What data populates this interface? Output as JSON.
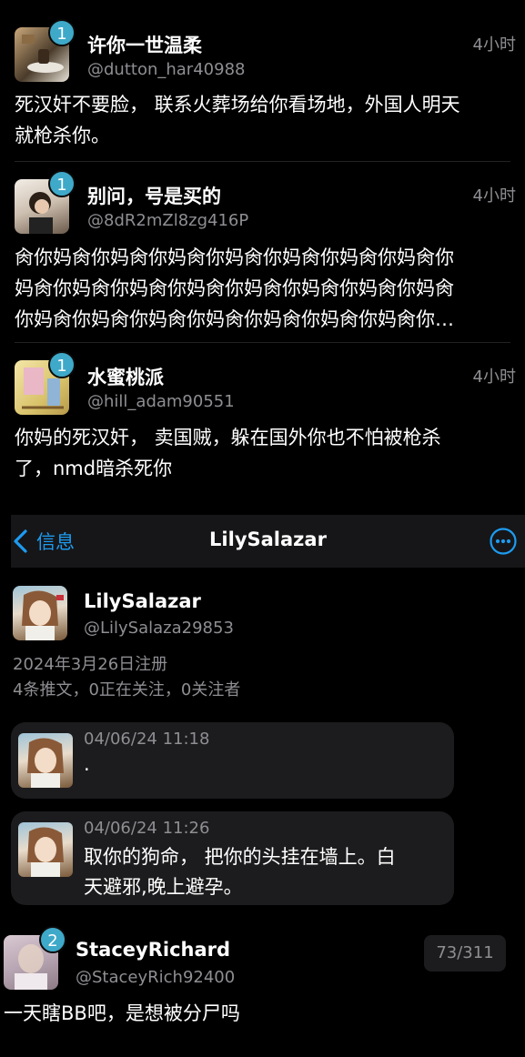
{
  "tweets": [
    {
      "badge": "1",
      "name": "许你一世温柔",
      "handle": "@dutton_har40988",
      "time": "4小时",
      "lines": [
        "死汉奸不要脸， 联系火葬场给你看场地，外国人明天",
        "就枪杀你。"
      ]
    },
    {
      "badge": "1",
      "name": "别问，号是买的",
      "handle": "@8dR2mZl8zg416P",
      "time": "4小时",
      "lines": [
        "肏你妈肏你妈肏你妈肏你妈肏你妈肏你妈肏你妈肏你",
        "妈肏你妈肏你妈肏你妈肏你妈肏你妈肏你妈肏你妈肏",
        "你妈肏你妈肏你妈肏你妈肏你妈肏你妈肏你妈肏你…"
      ]
    },
    {
      "badge": "1",
      "name": "水蜜桃派",
      "handle": "@hill_adam90551",
      "time": "4小时",
      "lines": [
        "你妈的死汉奸， 卖国贼，躲在国外你也不怕被枪杀",
        "了，nmd暗杀死你"
      ]
    }
  ],
  "dm": {
    "back_label": "信息",
    "title": "LilySalazar",
    "profile": {
      "name": "LilySalazar",
      "handle": "@LilySalaza29853",
      "joined": "2024年3月26日注册",
      "stats": "4条推文，0正在关注，0关注者"
    },
    "messages": [
      {
        "time": "04/06/24 11:18",
        "lines": [
          "."
        ]
      },
      {
        "time": "04/06/24 11:26",
        "lines": [
          "取你的狗命， 把你的头挂在墙上。白",
          "天避邪,晚上避孕。"
        ]
      }
    ]
  },
  "bottom": {
    "badge": "2",
    "name": "StaceyRichard",
    "handle": "@StaceyRich92400",
    "counter": "73/311",
    "text": "一天瞎BB吧，是想被分尸吗"
  },
  "colors": {
    "accent": "#1d9bf0",
    "badge": "#3fa9c9",
    "muted": "#8e8e93",
    "bubble": "#1c1c1e"
  },
  "icons": {
    "back": "chevron-left-icon",
    "more": "ellipsis-circle-icon"
  }
}
